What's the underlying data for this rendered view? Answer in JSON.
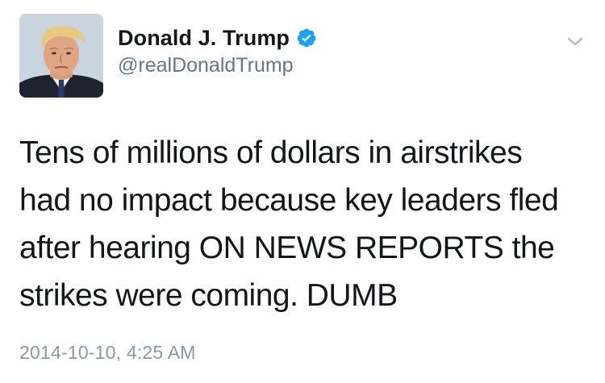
{
  "author": {
    "display_name": "Donald J. Trump",
    "handle": "@realDonaldTrump",
    "verified": true,
    "verified_icon": "verified-badge-icon",
    "avatar_icon": "profile-avatar"
  },
  "tweet": {
    "lines": [
      "Tens of millions of dollars in airstrikes",
      "had no impact because key leaders fled",
      "after hearing ON NEWS REPORTS the",
      "strikes were coming. DUMB"
    ],
    "timestamp": "2014-10-10, 4:25 AM"
  },
  "menu": {
    "icon": "chevron-down-icon"
  },
  "colors": {
    "verified_blue": "#1da1f2",
    "handle_gray": "#657786",
    "timestamp_gray": "#8899a6",
    "text": "#14171a"
  }
}
